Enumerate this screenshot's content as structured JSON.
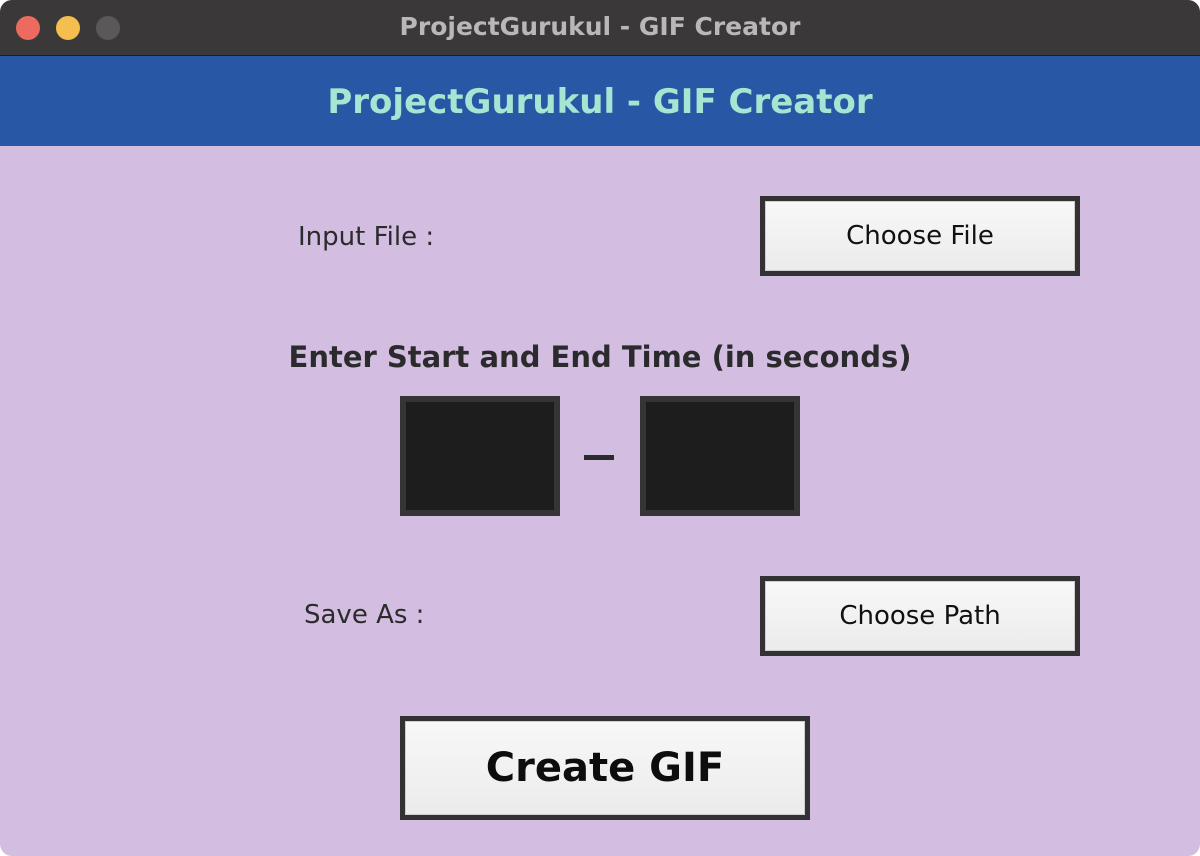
{
  "window": {
    "title": "ProjectGurukul - GIF Creator"
  },
  "header": {
    "title": "ProjectGurukul - GIF Creator"
  },
  "input_file": {
    "label": "Input File :",
    "button_label": "Choose File"
  },
  "time_range": {
    "heading": "Enter Start and End Time (in seconds)",
    "start_value": "",
    "end_value": ""
  },
  "save_as": {
    "label": "Save As :",
    "button_label": "Choose Path"
  },
  "actions": {
    "create_label": "Create GIF"
  },
  "colors": {
    "titlebar": "#3a3839",
    "header_bg": "#2858a5",
    "header_text": "#a5e6d3",
    "body_bg": "#d3bde0",
    "input_bg": "#1d1d1d"
  }
}
